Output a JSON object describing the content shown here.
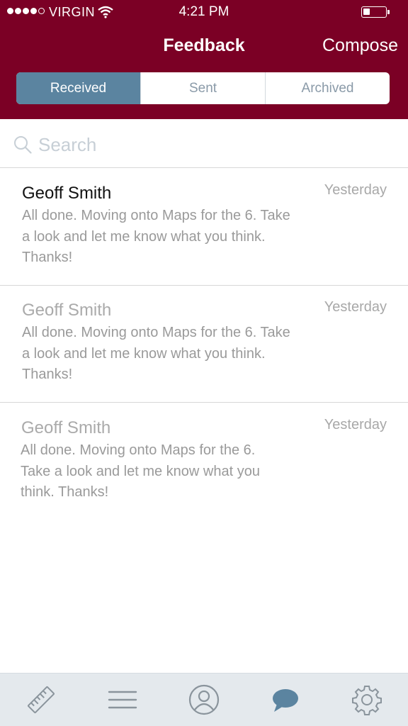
{
  "status_bar": {
    "carrier": "VIRGIN",
    "time": "4:21 PM",
    "battery_level": 0.3
  },
  "nav": {
    "title": "Feedback",
    "compose_label": "Compose"
  },
  "segments": [
    {
      "label": "Received",
      "active": true
    },
    {
      "label": "Sent",
      "active": false
    },
    {
      "label": "Archived",
      "active": false
    }
  ],
  "search": {
    "placeholder": "Search",
    "value": ""
  },
  "messages": [
    {
      "sender": "Geoff Smith",
      "date": "Yesterday",
      "body": "All done. Moving onto Maps for the 6. Take a look and let me know what you think. Thanks!",
      "unread": true
    },
    {
      "sender": "Geoff Smith",
      "date": "Yesterday",
      "body": "All done. Moving onto Maps for the 6. Take a look and let me know what you think. Thanks!",
      "unread": false
    },
    {
      "sender": "Geoff Smith",
      "date": "Yesterday",
      "body": "All done. Moving onto Maps for the 6. Take a look and let me know what you think. Thanks!",
      "unread": false
    }
  ],
  "tabbar": {
    "items": [
      {
        "icon": "ruler-icon",
        "active": false
      },
      {
        "icon": "menu-icon",
        "active": false
      },
      {
        "icon": "profile-icon",
        "active": false
      },
      {
        "icon": "chat-bubble-icon",
        "active": true
      },
      {
        "icon": "gear-icon",
        "active": false
      }
    ]
  },
  "colors": {
    "header_bg": "#7b0025",
    "segment_active": "#5b84a0",
    "tab_icon": "#8a949c",
    "tab_icon_active": "#5b84a0"
  }
}
